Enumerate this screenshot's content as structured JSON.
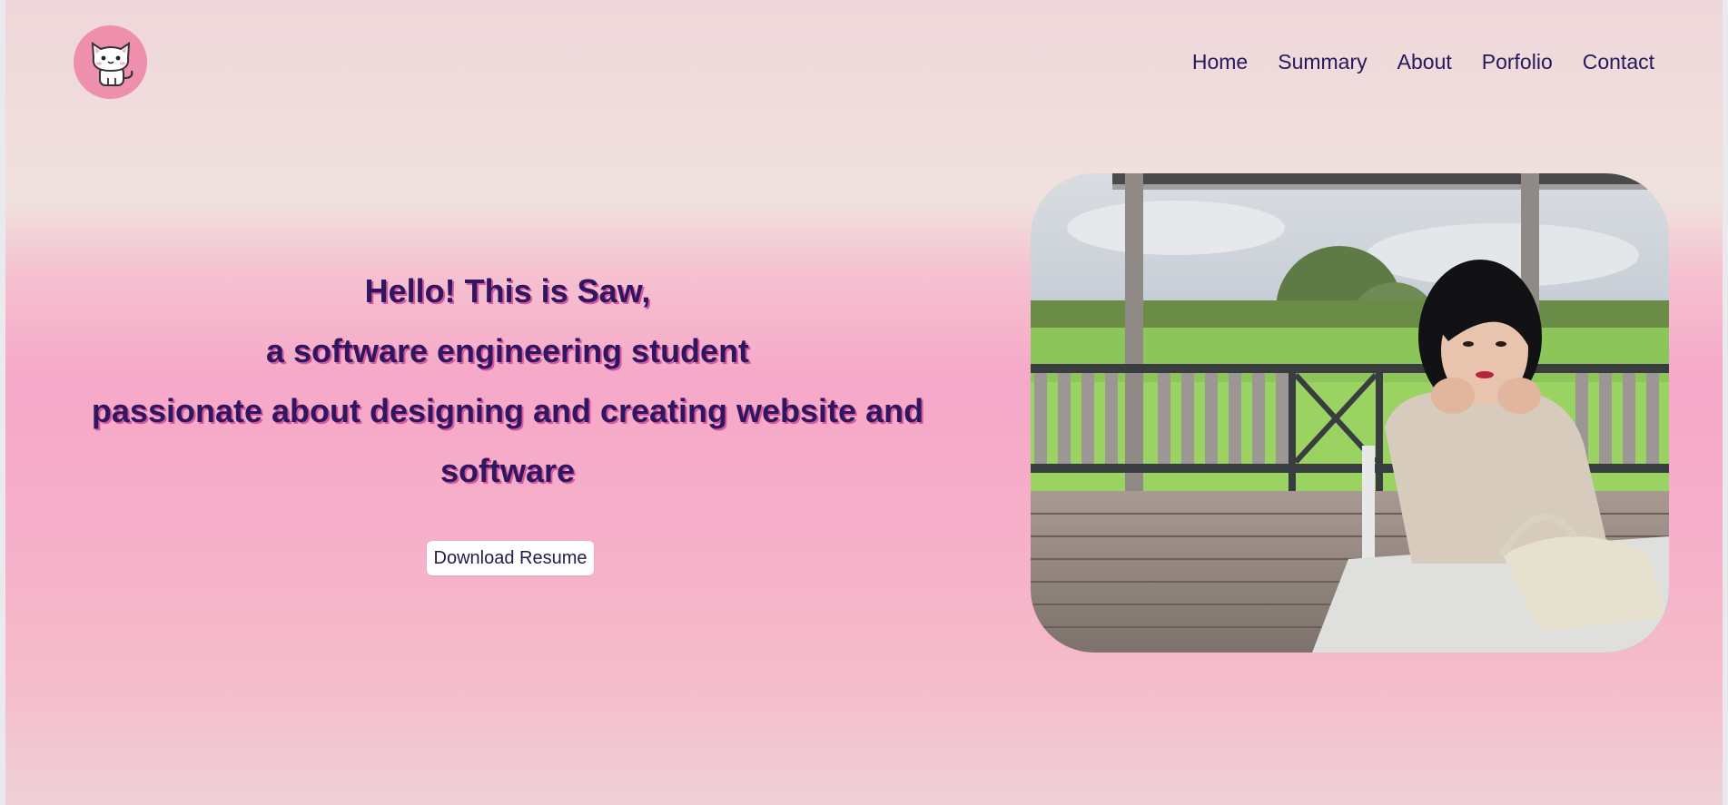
{
  "nav": {
    "items": [
      {
        "label": "Home"
      },
      {
        "label": "Summary"
      },
      {
        "label": "About"
      },
      {
        "label": "Porfolio"
      },
      {
        "label": "Contact"
      }
    ]
  },
  "logo": {
    "icon": "cat-icon"
  },
  "hero": {
    "lines": [
      "Hello! This is Saw,",
      "a software engineering student",
      "passionate about designing and creating website and",
      "software"
    ],
    "resume_button": "Download Resume"
  },
  "photo": {
    "icon": "profile-photo"
  },
  "colors": {
    "nav_text": "#24195a",
    "hero_text": "#2e1660",
    "hero_shadow": "#d8579c",
    "logo_bg": "#ef8fae"
  }
}
